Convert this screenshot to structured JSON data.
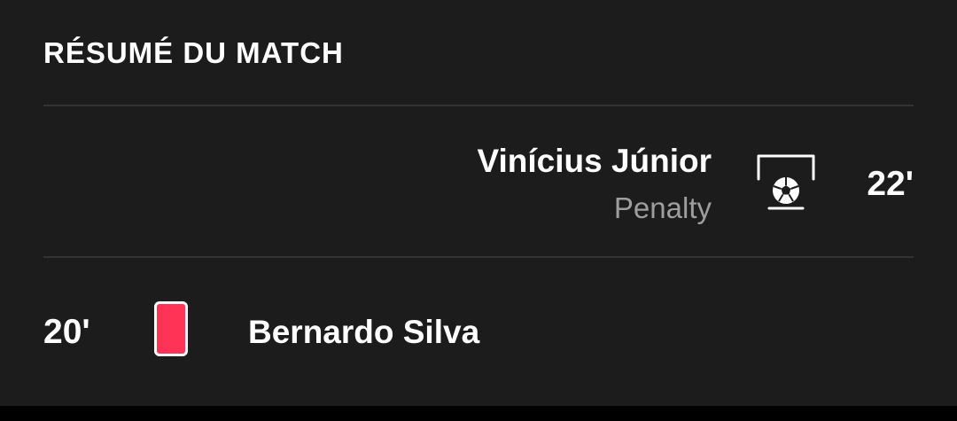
{
  "section": {
    "title": "RÉSUMÉ DU MATCH"
  },
  "events": [
    {
      "side": "away",
      "type": "penalty-goal",
      "player": "Vinícius Júnior",
      "detail": "Penalty",
      "minute": "22'",
      "icon": "penalty-goal-icon"
    },
    {
      "side": "home",
      "type": "red-card",
      "player": "Bernardo Silva",
      "minute": "20'",
      "icon": "red-card-icon",
      "card_color": "#ff3355"
    }
  ],
  "colors": {
    "background": "#1c1c1c",
    "divider": "#333333",
    "primary_text": "#ffffff",
    "secondary_text": "#9e9e9e",
    "red_card": "#ff3355"
  }
}
